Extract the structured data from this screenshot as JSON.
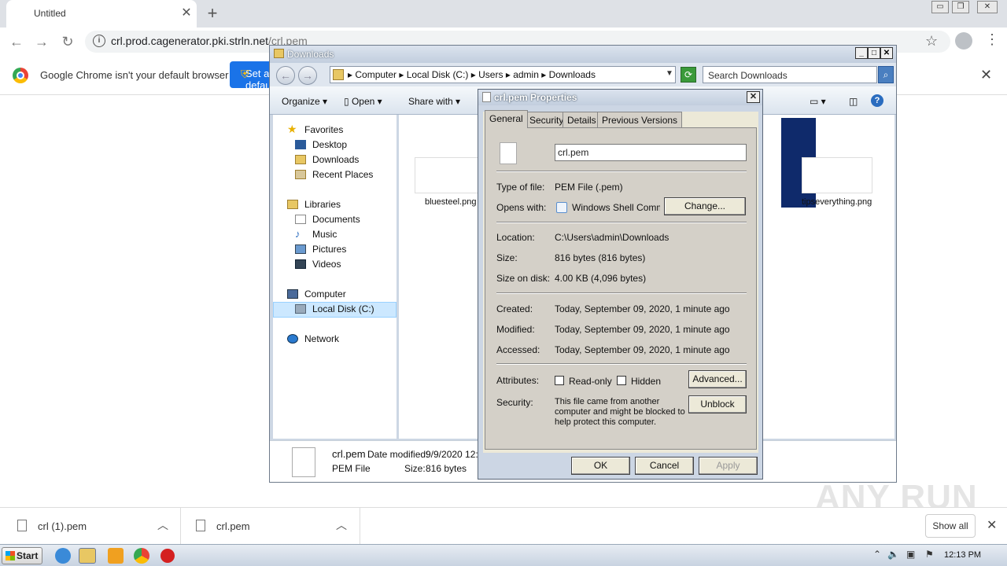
{
  "browser": {
    "tab_title": "Untitled",
    "url_host": "crl.prod.cagenerator.pki.strln.net",
    "url_path": "/crl.pem",
    "infobar_text": "Google Chrome isn't your default browser",
    "infobar_button": "Set as default"
  },
  "downloads": {
    "items": [
      {
        "name": "crl (1).pem"
      },
      {
        "name": "crl.pem"
      }
    ],
    "show_all": "Show all"
  },
  "explorer": {
    "title": "Downloads",
    "breadcrumbs": [
      "Computer",
      "Local Disk (C:)",
      "Users",
      "admin",
      "Downloads"
    ],
    "search_placeholder": "Search Downloads",
    "commands": {
      "organize": "Organize",
      "open": "Open",
      "share": "Share with"
    },
    "nav": {
      "favorites": "Favorites",
      "desktop": "Desktop",
      "downloads": "Downloads",
      "recent": "Recent Places",
      "libraries": "Libraries",
      "documents": "Documents",
      "music": "Music",
      "pictures": "Pictures",
      "videos": "Videos",
      "computer": "Computer",
      "local_disk": "Local Disk (C:)",
      "network": "Network"
    },
    "files": [
      {
        "name": "bluesteel.png"
      },
      {
        "name": "tipseverything.png"
      }
    ],
    "details": {
      "name": "crl.pem",
      "modified_label": "Date modified:",
      "modified_value": "9/9/2020 12:",
      "type": "PEM File",
      "size_label": "Size:",
      "size_value": "816 bytes"
    }
  },
  "dialog": {
    "title": "crl.pem Properties",
    "tabs": [
      "General",
      "Security",
      "Details",
      "Previous Versions"
    ],
    "filename": "crl.pem",
    "type_label": "Type of file:",
    "type_value": "PEM File (.pem)",
    "opens_label": "Opens with:",
    "opens_value": "Windows Shell Commor",
    "change_button": "Change...",
    "location_label": "Location:",
    "location_value": "C:\\Users\\admin\\Downloads",
    "size_label": "Size:",
    "size_value": "816 bytes (816 bytes)",
    "size_disk_label": "Size on disk:",
    "size_disk_value": "4.00 KB (4,096 bytes)",
    "created_label": "Created:",
    "created_value": "Today, September 09, 2020, 1 minute ago",
    "modified_label": "Modified:",
    "modified_value": "Today, September 09, 2020, 1 minute ago",
    "accessed_label": "Accessed:",
    "accessed_value": "Today, September 09, 2020, 1 minute ago",
    "attributes_label": "Attributes:",
    "readonly_label": "Read-only",
    "hidden_label": "Hidden",
    "advanced_button": "Advanced...",
    "security_label": "Security:",
    "security_text_1": "This file came from another",
    "security_text_2": "computer and might be blocked to",
    "security_text_3": "help protect this computer.",
    "unblock_button": "Unblock",
    "ok_button": "OK",
    "cancel_button": "Cancel",
    "apply_button": "Apply"
  },
  "taskbar": {
    "start": "Start",
    "clock": "12:13 PM"
  },
  "watermark": "ANY RUN"
}
